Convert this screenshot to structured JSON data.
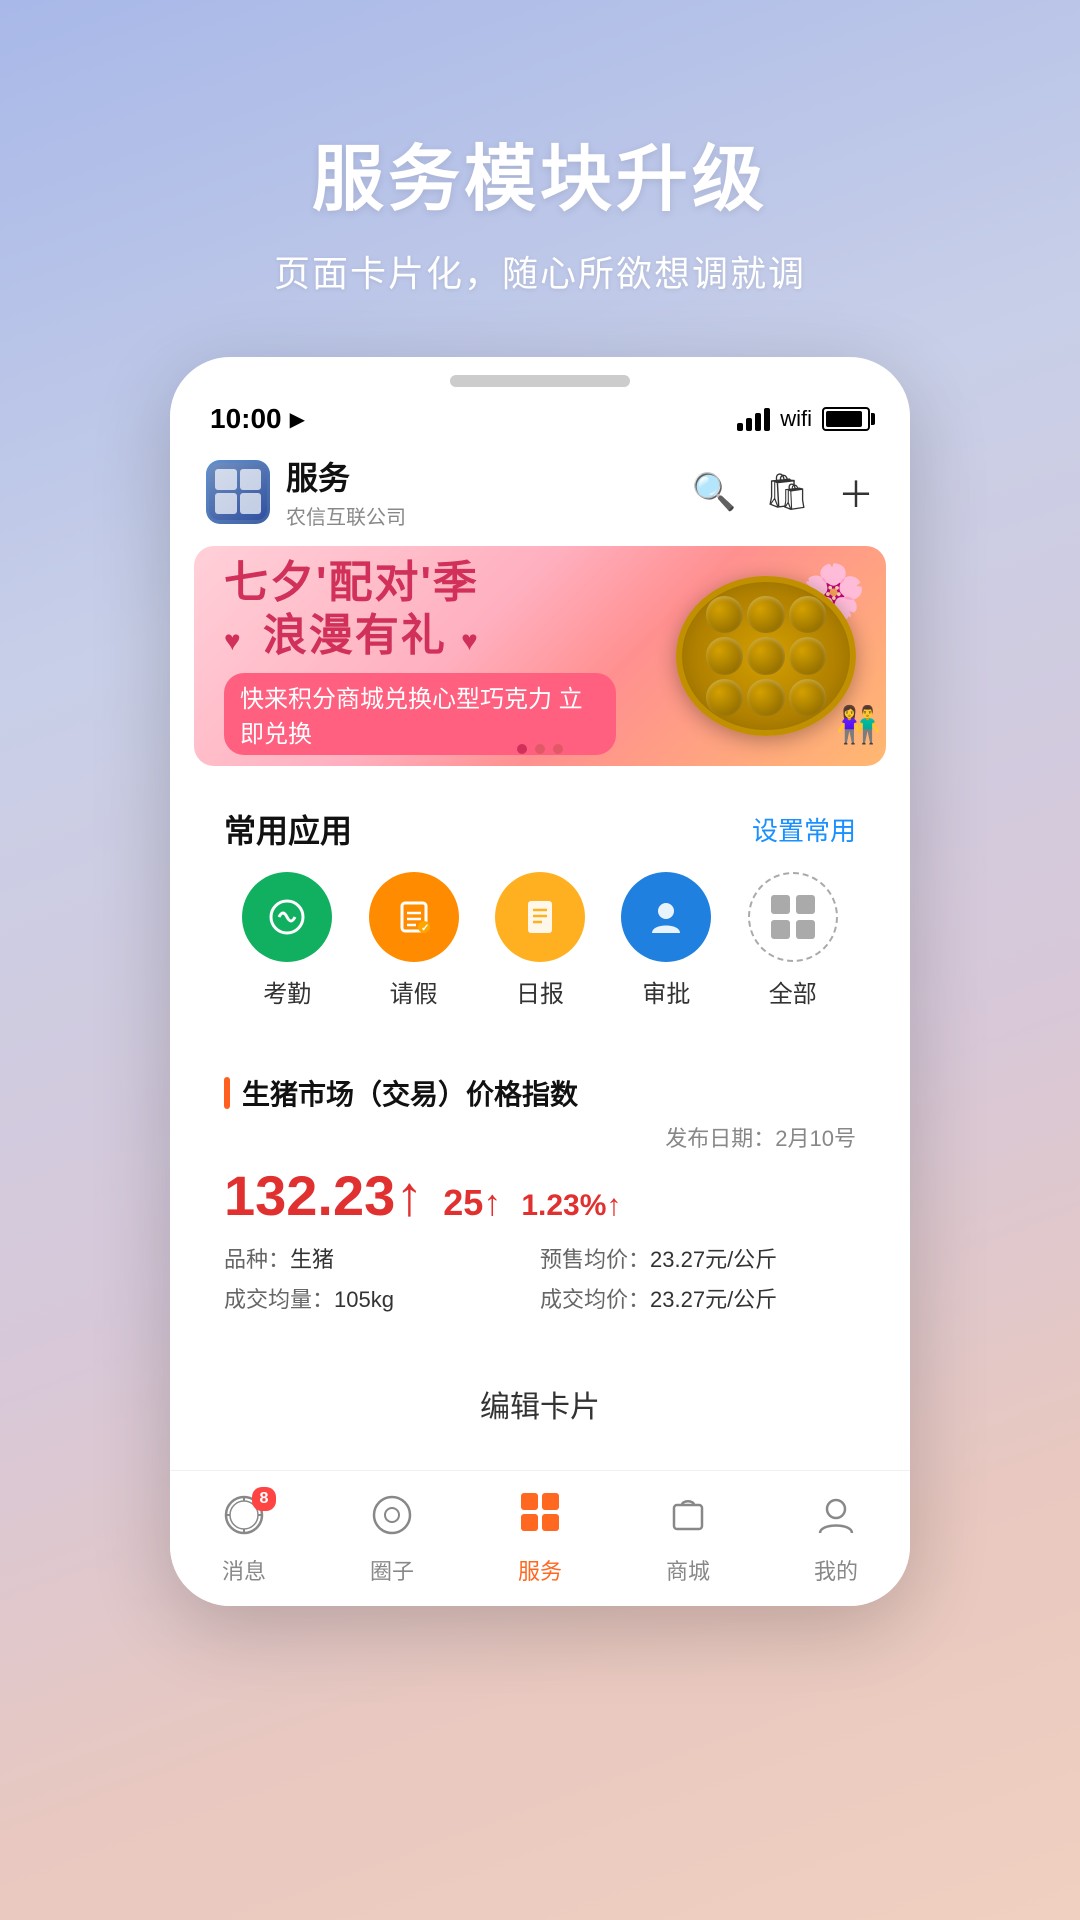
{
  "hero": {
    "title": "服务模块升级",
    "subtitle": "页面卡片化，随心所欲想调就调"
  },
  "statusBar": {
    "time": "10:00",
    "location_arrow": "▶"
  },
  "appHeader": {
    "name": "服务",
    "sub": "农信互联公司",
    "search_label": "搜索",
    "cart_label": "购物车",
    "add_label": "添加"
  },
  "banner": {
    "title_line1": "七夕'配对'季",
    "title_line2": "浪漫有礼",
    "subtitle": "快来积分商城兑换心型巧克力  立即兑换",
    "dots": [
      true,
      false,
      false
    ]
  },
  "commonApps": {
    "section_title": "常用应用",
    "action_label": "设置常用",
    "items": [
      {
        "id": "attendance",
        "label": "考勤",
        "color": "green",
        "icon": "⚡"
      },
      {
        "id": "leave",
        "label": "请假",
        "color": "orange",
        "icon": "📋"
      },
      {
        "id": "daily",
        "label": "日报",
        "color": "yellow",
        "icon": "📄"
      },
      {
        "id": "approval",
        "label": "审批",
        "color": "blue",
        "icon": "👤"
      },
      {
        "id": "all",
        "label": "全部",
        "color": "outline",
        "icon": ""
      }
    ]
  },
  "marketIndex": {
    "title": "生猪市场（交易）价格指数",
    "date_label": "发布日期：",
    "date_value": "2月10号",
    "price_main": "132.23",
    "price_up_arrow": "↑",
    "change_value": "25",
    "change_arrow": "↑",
    "change_pct": "1.23%",
    "change_pct_arrow": "↑",
    "details": [
      {
        "label": "品种：",
        "value": "生猪"
      },
      {
        "label": "预售均价：",
        "value": "23.27元/公斤"
      },
      {
        "label": "成交均量：",
        "value": "105kg"
      },
      {
        "label": "成交均价：",
        "value": "23.27元/公斤"
      }
    ]
  },
  "editCard": {
    "label": "编辑卡片"
  },
  "bottomNav": {
    "items": [
      {
        "id": "messages",
        "label": "消息",
        "icon": "💬",
        "badge": "8",
        "active": false
      },
      {
        "id": "circle",
        "label": "圈子",
        "icon": "◎",
        "badge": "",
        "active": false
      },
      {
        "id": "service",
        "label": "服务",
        "icon": "⊞",
        "badge": "",
        "active": true
      },
      {
        "id": "shop",
        "label": "商城",
        "icon": "🛍",
        "badge": "",
        "active": false
      },
      {
        "id": "mine",
        "label": "我的",
        "icon": "👤",
        "badge": "",
        "active": false
      }
    ]
  }
}
